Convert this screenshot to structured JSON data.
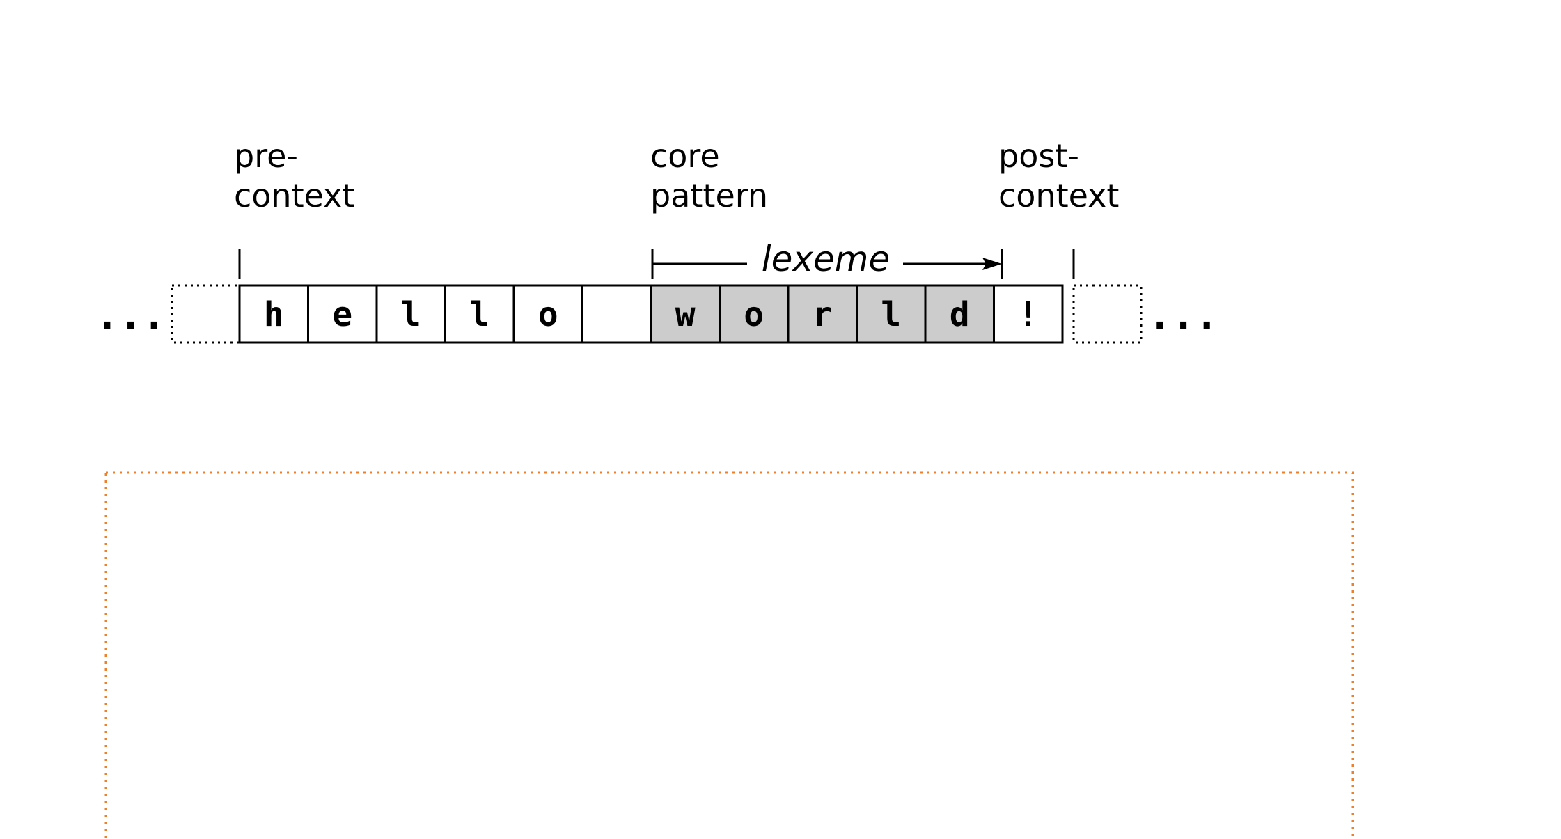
{
  "labels": {
    "pre_context": [
      "pre-",
      "context"
    ],
    "core_pattern": [
      "core",
      "pattern"
    ],
    "post_context": [
      "post-",
      "context"
    ]
  },
  "lexeme_label": "lexeme",
  "ellipsis_left": "...",
  "ellipsis_right": "...",
  "cells": [
    {
      "char": "h",
      "highlight": false
    },
    {
      "char": "e",
      "highlight": false
    },
    {
      "char": "l",
      "highlight": false
    },
    {
      "char": "l",
      "highlight": false
    },
    {
      "char": "o",
      "highlight": false
    },
    {
      "char": "",
      "highlight": false
    },
    {
      "char": "w",
      "highlight": true
    },
    {
      "char": "o",
      "highlight": true
    },
    {
      "char": "r",
      "highlight": true
    },
    {
      "char": "l",
      "highlight": true
    },
    {
      "char": "d",
      "highlight": true
    },
    {
      "char": "!",
      "highlight": false
    }
  ],
  "colors": {
    "highlight_fill": "#cccccc",
    "cell_fill": "#ffffff",
    "frame_stroke": "#f07f2a"
  }
}
